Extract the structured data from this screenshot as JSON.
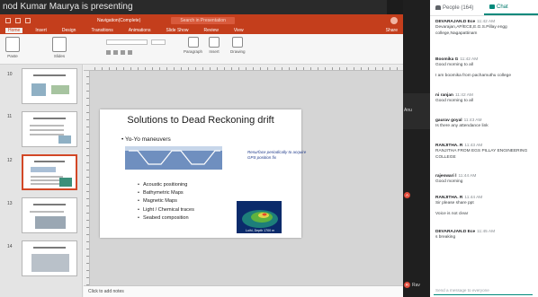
{
  "meeting": {
    "presenting_banner": "nod Kumar Maurya is presenting"
  },
  "ppt": {
    "document_title": "Navigation(Complete)",
    "search_placeholder": "Search in Presentation",
    "tabs": [
      "Home",
      "Insert",
      "Design",
      "Transitions",
      "Animations",
      "Slide Show",
      "Review",
      "View"
    ],
    "share_label": "Share",
    "ribbon": {
      "paste": "Paste",
      "slides": "Slides",
      "paragraph": "Paragraph",
      "insert": "Insert",
      "drawing": "Drawing"
    },
    "slide_numbers": [
      "10",
      "11",
      "12",
      "13",
      "14"
    ],
    "selected_slide": "12",
    "slide": {
      "title": "Solutions to Dead Reckoning drift",
      "main_bullet": "Yo-Yo maneuvers",
      "caption": "Resurface periodically to acquire GPS position fix",
      "bullets": [
        "Acoustic positioning",
        "Bathymetric Maps",
        "Magnetic Maps",
        "Light / Chemical traces",
        "Seabed composition"
      ],
      "image_caption": "Loihi, Depth 1700 m"
    },
    "notes_placeholder": "Click to add notes"
  },
  "participants": [
    {
      "name": "Anu",
      "initial": "A",
      "color": "#e14b3a"
    },
    {
      "name": "Rav",
      "initial": "R",
      "color": "#e14b3a"
    }
  ],
  "chat_panel": {
    "people_tab": "People (164)",
    "chat_tab": "Chat",
    "compose_placeholder": "Send a message to everyone",
    "messages": [
      {
        "sender": "DEVARAJAN.D Ece",
        "time": "11:42 AM",
        "lines": [
          "Devarajan,AP/ECE,E.G.S.Pillay engg college,Nagapattinam"
        ]
      },
      {
        "sender": "Boomika G",
        "time": "11:42 AM",
        "lines": [
          "Good morning to all",
          "I am boomika from pachamuthu college"
        ]
      },
      {
        "sender": "ni ranjan",
        "time": "11:42 AM",
        "lines": [
          "Good morning to all"
        ]
      },
      {
        "sender": "gaurav goyal",
        "time": "11:43 AM",
        "lines": [
          "Is there any attendance link"
        ]
      },
      {
        "sender": "RANJITHA. R",
        "time": "11:43 AM",
        "lines": [
          "RANJITHA FROM EGS PILLAY ENGINEERING COLLEGE"
        ]
      },
      {
        "sender": "rajeswari l",
        "time": "11:44 AM",
        "lines": [
          "Good morning"
        ]
      },
      {
        "sender": "RANJITHA. R",
        "time": "11:44 AM",
        "lines": [
          "Sir please share ppt",
          "Voice is not clear"
        ]
      },
      {
        "sender": "DEVARAJAN.D Ece",
        "time": "11:45 AM",
        "lines": [
          "s breaking"
        ]
      }
    ]
  }
}
